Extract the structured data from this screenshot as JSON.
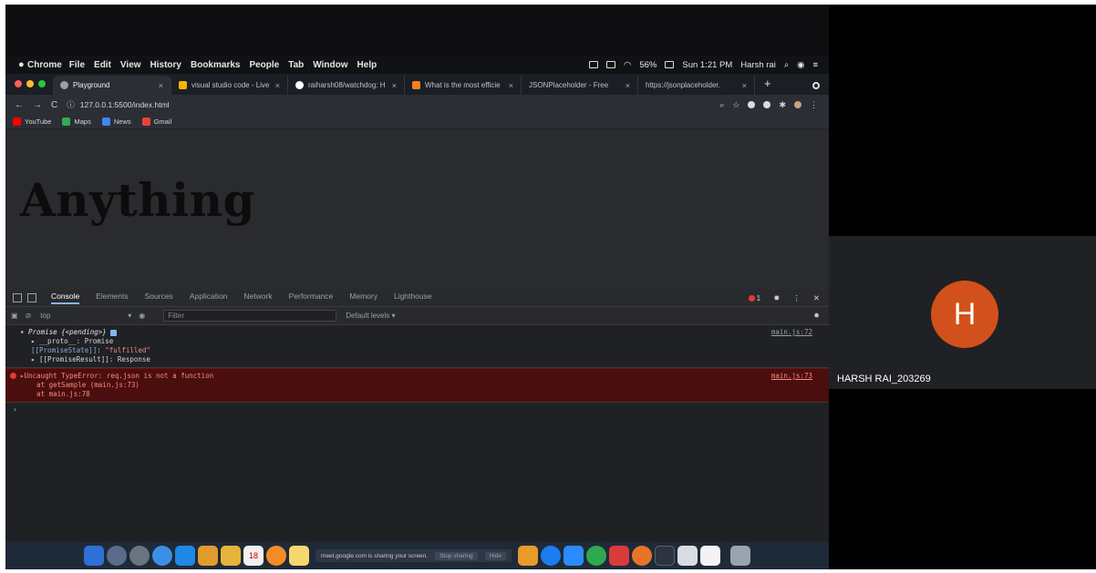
{
  "macbar": {
    "app": "Chrome",
    "menus": [
      "File",
      "Edit",
      "View",
      "History",
      "Bookmarks",
      "People",
      "Tab",
      "Window",
      "Help"
    ],
    "battery": "56%",
    "datetime": "Sun 1:21 PM",
    "user": "Harsh rai"
  },
  "tabs": [
    {
      "title": "Playground",
      "active": true,
      "color": "#9aa0a6"
    },
    {
      "title": "visual studio code - Live",
      "active": false,
      "color": "#f4b400"
    },
    {
      "title": "raiharsh08/watchdog: H",
      "active": false,
      "color": "#ffffff"
    },
    {
      "title": "What is the most efficie",
      "active": false,
      "color": "#f48024"
    },
    {
      "title": "JSONPlaceholder - Free",
      "active": false,
      "color": "#555555"
    },
    {
      "title": "https://jsonplaceholder.",
      "active": false,
      "color": "#555555"
    }
  ],
  "address": {
    "url": "127.0.0.1:5500/index.html"
  },
  "bookmarks": [
    {
      "label": "YouTube",
      "color": "#ff0000"
    },
    {
      "label": "Maps",
      "color": "#34a853"
    },
    {
      "label": "News",
      "color": "#4285f4"
    },
    {
      "label": "Gmail",
      "color": "#ea4335"
    }
  ],
  "page": {
    "heading": "Anything"
  },
  "devtools": {
    "tabs": [
      "Console",
      "Elements",
      "Sources",
      "Application",
      "Network",
      "Performance",
      "Memory",
      "Lighthouse"
    ],
    "error_count": "1",
    "context": "top",
    "filter_placeholder": "Filter",
    "levels": "Default levels ▾"
  },
  "console": {
    "promise_header": "▾ Promise {<pending>}",
    "proto_line": "▸ __proto__: Promise",
    "state_key": "[[PromiseState]]",
    "state_val": "\"fulfilled\"",
    "result_line": "▸ [[PromiseResult]]: Response",
    "promise_src": "main.js:72",
    "error_line1": "▸Uncaught TypeError: req.json is not a function",
    "error_line2": "    at getSample (main.js:73)",
    "error_line3": "    at main.js:78",
    "error_src": "main.js:73",
    "prompt": "›"
  },
  "dock": {
    "share_text": "meet.google.com is sharing your screen.",
    "stop_label": "Stop sharing",
    "hide_label": "Hide",
    "calendar_day": "18"
  },
  "participant": {
    "initial": "H",
    "name": "HARSH RAI_203269",
    "color": "#d2501b"
  }
}
